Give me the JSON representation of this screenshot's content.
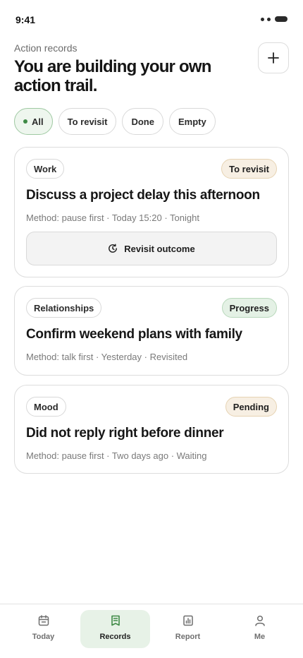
{
  "status": {
    "time": "9:41"
  },
  "header": {
    "subtitle": "Action records",
    "title": "You are building your own action trail."
  },
  "filters": [
    {
      "label": "All",
      "active": true
    },
    {
      "label": "To revisit"
    },
    {
      "label": "Done"
    },
    {
      "label": "Empty"
    }
  ],
  "records": [
    {
      "tag": "Work",
      "status": "To revisit",
      "title": "Discuss a project delay this afternoon",
      "meta": "Method: pause first · Today 15:20 · Tonight",
      "action_label": "Revisit outcome"
    },
    {
      "tag": "Relationships",
      "status": "Progress",
      "title": "Confirm weekend plans with family",
      "meta": "Method: talk first · Yesterday · Revisited"
    },
    {
      "tag": "Mood",
      "status": "Pending",
      "title": "Did not reply right before dinner",
      "meta": "Method: pause first · Two days ago · Waiting"
    }
  ],
  "tabbar": [
    {
      "label": "Today",
      "icon": "calendar-icon"
    },
    {
      "label": "Records",
      "icon": "notebook-icon",
      "active": true
    },
    {
      "label": "Report",
      "icon": "bar-chart-icon"
    },
    {
      "label": "Me",
      "icon": "person-icon"
    }
  ],
  "colors": {
    "accent_green": "#3f8a46",
    "chip_active_bg": "#eef6ee",
    "badge_warm_bg": "#f7efe3",
    "badge_green_bg": "#e4f1e5",
    "tab_active_bg": "#e7f2e7"
  }
}
